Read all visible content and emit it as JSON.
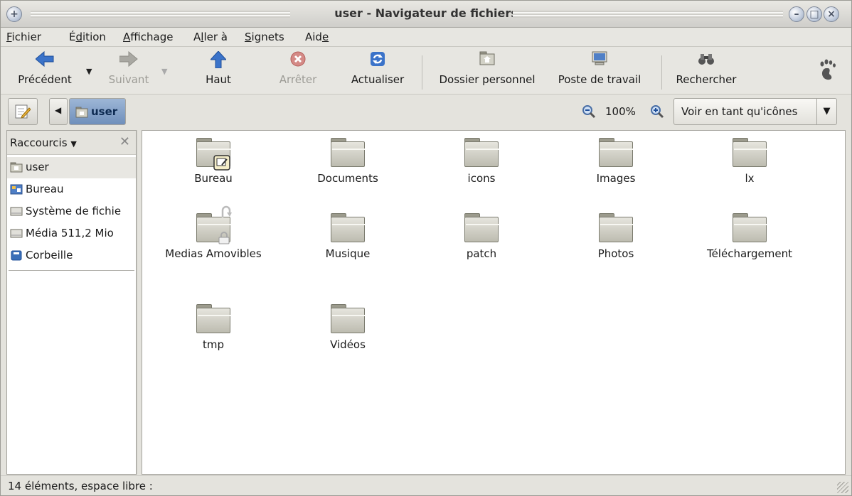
{
  "window": {
    "title": "user - Navigateur de fichiers"
  },
  "menubar": {
    "items": [
      {
        "u": "F",
        "rest": "ichier"
      },
      {
        "pre": "É",
        "u": "d",
        "rest": "ition"
      },
      {
        "u": "A",
        "rest": "ffichage"
      },
      {
        "pre": "A",
        "u": "l",
        "rest": "ler à"
      },
      {
        "u": "S",
        "rest": "ignets"
      },
      {
        "pre": "Aid",
        "u": "e",
        "rest": ""
      }
    ]
  },
  "toolbar": {
    "back": "Précédent",
    "forward": "Suivant",
    "up": "Haut",
    "stop": "Arrêter",
    "reload": "Actualiser",
    "home": "Dossier personnel",
    "computer": "Poste de travail",
    "search": "Rechercher"
  },
  "location": {
    "crumb": "user",
    "zoom": "100%",
    "view_mode": "Voir en tant qu'icônes"
  },
  "sidebar": {
    "title": "Raccourcis",
    "items": [
      {
        "label": "user",
        "icon": "home-folder-icon"
      },
      {
        "label": "Bureau",
        "icon": "desktop-icon"
      },
      {
        "label": "Système de fichie",
        "icon": "drive-icon"
      },
      {
        "label": "Média 511,2 Mio",
        "icon": "drive-icon"
      },
      {
        "label": "Corbeille",
        "icon": "trash-icon"
      }
    ]
  },
  "files": [
    "Bureau",
    "Documents",
    "icons",
    "Images",
    "lx",
    "Medias Amovibles",
    "Musique",
    "patch",
    "Photos",
    "Téléchargement",
    "tmp",
    "Vidéos"
  ],
  "status": {
    "text": "14 éléments, espace libre :"
  }
}
